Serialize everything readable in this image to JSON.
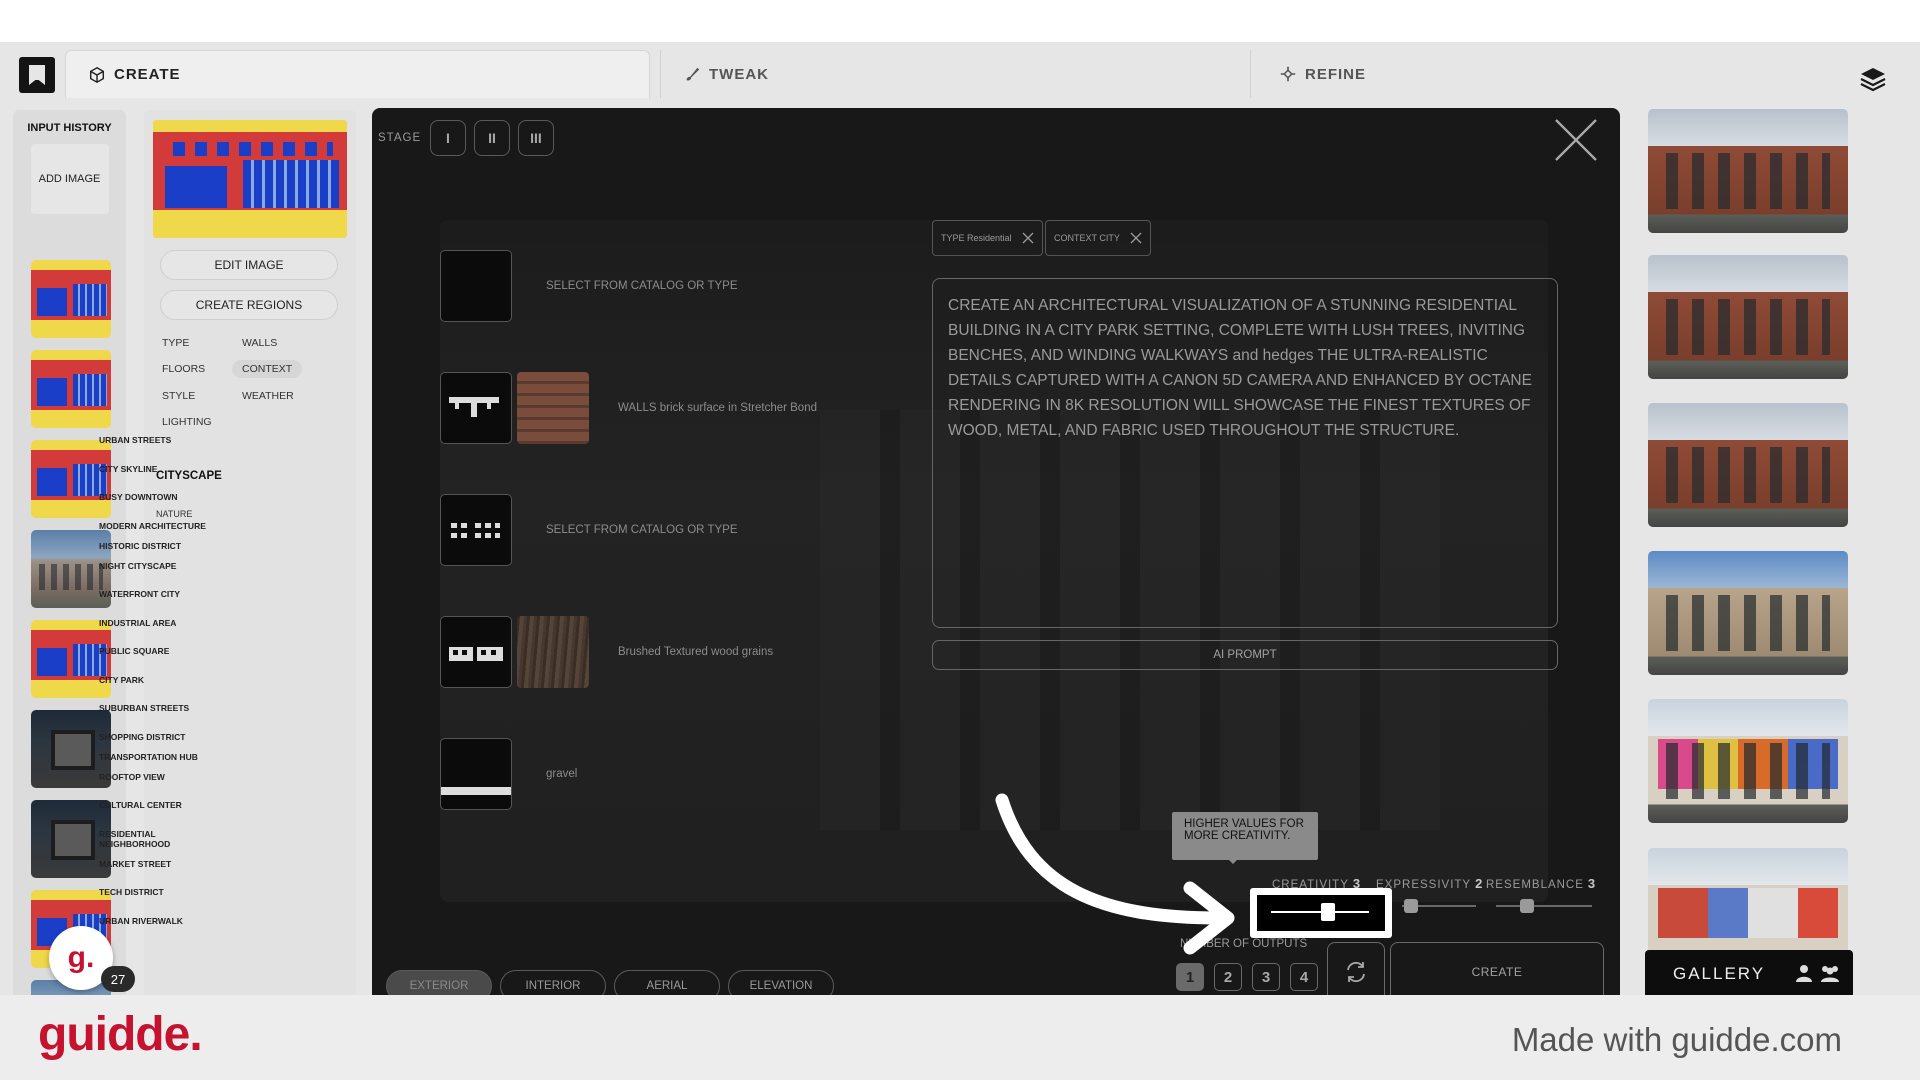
{
  "header": {
    "tabs": [
      {
        "label": "CREATE"
      },
      {
        "label": "TWEAK"
      },
      {
        "label": "REFINE"
      }
    ]
  },
  "history": {
    "title": "INPUT HISTORY",
    "add_label": "ADD IMAGE",
    "avatar_letter": "g.",
    "badge_count": "27"
  },
  "panel": {
    "edit_image": "EDIT IMAGE",
    "create_regions": "CREATE REGIONS",
    "categories": {
      "type": "TYPE",
      "walls": "WALLS",
      "floors": "FLOORS",
      "context": "CONTEXT",
      "style": "STYLE",
      "weather": "WEATHER",
      "lighting": "LIGHTING"
    },
    "section": "CITYSCAPE",
    "subnav": "NATURE",
    "context_options": [
      "URBAN STREETS",
      "CITY SKYLINE",
      "BUSY DOWNTOWN",
      "MODERN ARCHITECTURE",
      "HISTORIC DISTRICT",
      "NIGHT CITYSCAPE",
      "WATERFRONT CITY",
      "INDUSTRIAL AREA",
      "PUBLIC SQUARE",
      "CITY PARK",
      "SUBURBAN STREETS",
      "SHOPPING DISTRICT",
      "TRANSPORTATION HUB",
      "ROOFTOP VIEW",
      "CULTURAL CENTER",
      "RESIDENTIAL NEIGHBORHOOD",
      "MARKET STREET",
      "TECH DISTRICT",
      "URBAN RIVERWALK"
    ]
  },
  "modal": {
    "stage_label": "STAGE",
    "stages": [
      "I",
      "II",
      "III"
    ],
    "materials": [
      {
        "label": "SELECT FROM CATALOG OR TYPE"
      },
      {
        "label": "WALLS brick surface in Stretcher Bond"
      },
      {
        "label": "SELECT FROM CATALOG OR TYPE"
      },
      {
        "label": "Brushed Textured wood grains"
      },
      {
        "label": "gravel"
      }
    ],
    "chips": [
      {
        "label": "TYPE Residential"
      },
      {
        "label": "CONTEXT CITY"
      }
    ],
    "prompt_text": "CREATE AN ARCHITECTURAL VISUALIZATION OF A STUNNING RESIDENTIAL BUILDING IN A CITY PARK SETTING, COMPLETE WITH LUSH TREES, INVITING BENCHES, AND WINDING WALKWAYS and hedges THE ULTRA-REALISTIC DETAILS CAPTURED WITH A CANON 5D CAMERA AND ENHANCED BY OCTANE RENDERING IN 8K RESOLUTION WILL SHOWCASE THE FINEST TEXTURES OF WOOD, METAL, AND FABRIC USED THROUGHOUT THE STRUCTURE.",
    "ai_prompt": "AI PROMPT",
    "tooltip": "HIGHER VALUES FOR MORE CREATIVITY.",
    "sliders": [
      {
        "label": "CREATIVITY",
        "value": "3"
      },
      {
        "label": "EXPRESSIVITY",
        "value": "2"
      },
      {
        "label": "RESEMBLANCE",
        "value": "3"
      }
    ],
    "outputs_label": "NUMBER OF OUTPUTS",
    "outputs": [
      "1",
      "2",
      "3",
      "4"
    ],
    "create_label": "CREATE",
    "views": [
      {
        "label": "EXTERIOR"
      },
      {
        "label": "INTERIOR"
      },
      {
        "label": "AERIAL"
      },
      {
        "label": "ELEVATION"
      }
    ]
  },
  "gallery": {
    "label": "GALLERY"
  },
  "footer": {
    "brand": "guidde.",
    "made_with": "Made with guidde.com"
  },
  "colors": {
    "brand_red": "#c4122f",
    "modal_bg": "#181818",
    "app_bg": "#e6e6e6"
  }
}
